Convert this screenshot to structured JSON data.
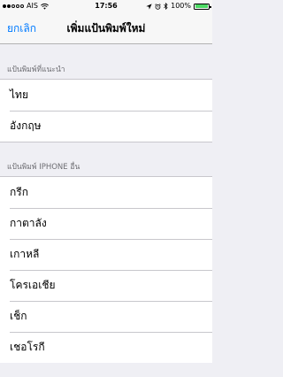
{
  "status_bar": {
    "carrier": "AIS",
    "time": "17:56",
    "battery": "100%",
    "signal_dots": [
      true,
      true,
      false,
      false,
      false
    ]
  },
  "nav": {
    "cancel": "ยกเลิก",
    "title": "เพิ่มแป้นพิมพ์ใหม่"
  },
  "sections": [
    {
      "header": "แป้นพิมพ์ที่แนะนำ",
      "items": [
        "ไทย",
        "อังกฤษ"
      ]
    },
    {
      "header": "แป้นพิมพ์ IPHONE อื่น",
      "items": [
        "กรีก",
        "กาตาลัง",
        "เกาหลี",
        "โครเอเชีย",
        "เช็ก",
        "เชอโรกี"
      ]
    }
  ],
  "colors": {
    "accent": "#007aff",
    "background": "#efeff4",
    "battery": "#4cd964"
  }
}
